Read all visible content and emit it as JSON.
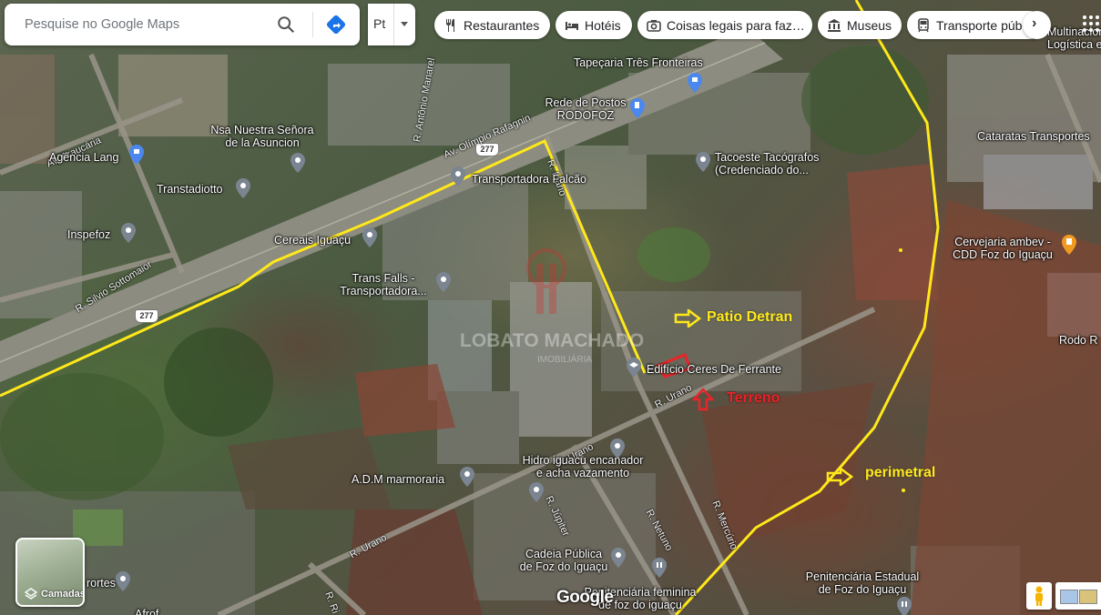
{
  "search": {
    "placeholder": "Pesquise no Google Maps",
    "search_icon": "search-icon",
    "directions_icon": "directions-icon"
  },
  "language": {
    "label": "Pt"
  },
  "chips": [
    {
      "label": "Restaurantes",
      "icon": "restaurant-icon"
    },
    {
      "label": "Hotéis",
      "icon": "hotel-icon"
    },
    {
      "label": "Coisas legais para faz…",
      "icon": "camera-icon"
    },
    {
      "label": "Museus",
      "icon": "museum-icon"
    },
    {
      "label": "Transporte púb",
      "icon": "transit-icon"
    }
  ],
  "roads": {
    "route_shield": "277"
  },
  "places": [
    {
      "name": "Tapeçaria Três Fronteiras"
    },
    {
      "name": "Rede de Postos\nRODOFOZ"
    },
    {
      "name": "Nsa Nuestra Señora\nde la Asuncion"
    },
    {
      "name": "Agência Lang"
    },
    {
      "name": "Transtadiotto"
    },
    {
      "name": "Transportadora Falcão"
    },
    {
      "name": "Tacoeste Tacógrafos\n(Credenciado do..."
    },
    {
      "name": "Inspefoz"
    },
    {
      "name": "Cereais Iguaçu"
    },
    {
      "name": "Trans Falls -\nTransportadora..."
    },
    {
      "name": "Cataratas Transportes"
    },
    {
      "name": "Multinacional\nLogística e..."
    },
    {
      "name": "Cervejaria ambev -\nCDD Foz do Iguaçu"
    },
    {
      "name": "Rodo R"
    },
    {
      "name": "Edifício Ceres De Ferrante"
    },
    {
      "name": "Hidro iguacu encanador\ne acha vazamento"
    },
    {
      "name": "A.D.M marmoraria"
    },
    {
      "name": "Cadeia Pública\nde Foz do Iguaçu"
    },
    {
      "name": "Penitenciária feminina\nde foz do iguaçu"
    },
    {
      "name": "Penitenciária Estadual\nde Foz do Iguaçu"
    },
    {
      "name": "rortes"
    },
    {
      "name": "Afrof"
    }
  ],
  "streets": [
    {
      "name": "Av. Araucária"
    },
    {
      "name": "Av. Olímpio Rafagnin"
    },
    {
      "name": "R. Antônio Manarel"
    },
    {
      "name": "R. Mário"
    },
    {
      "name": "R. Silvio Sottomaior"
    },
    {
      "name": "R. Urano"
    },
    {
      "name": "R. Urano"
    },
    {
      "name": "R. Urano"
    },
    {
      "name": "R. Netuno"
    },
    {
      "name": "R. Mercúrio"
    },
    {
      "name": "R. Júpiter"
    },
    {
      "name": "R. Ri"
    }
  ],
  "annotations": {
    "patio": "Patio Detran",
    "terreno": "Terreno",
    "perimetral": "perimetral",
    "color_yellow": "#ffe81a",
    "color_red": "#e8252a"
  },
  "watermark": {
    "text": "LOBATO MACHADO",
    "sub": "IMOBILIÁRIA"
  },
  "controls": {
    "layers_label": "Camadas",
    "google_logo": "Google",
    "next_icon": "chevron-right-icon",
    "apps_icon": "apps-grid-icon",
    "pegman_icon": "pegman-icon"
  }
}
